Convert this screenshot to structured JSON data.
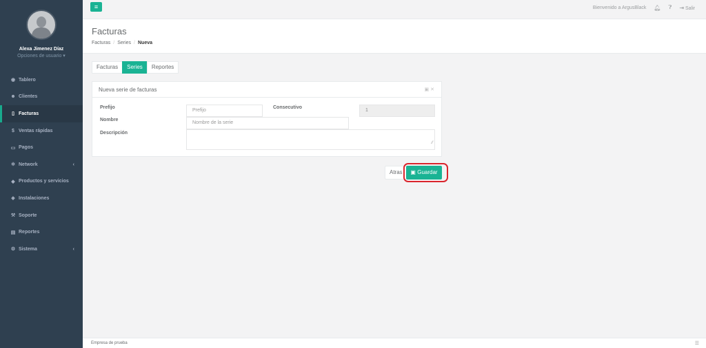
{
  "sidebar": {
    "user_name": "Alexa Jimenez Díaz",
    "user_options": "Opciones de usuario ▾",
    "items": [
      {
        "label": "Tablero",
        "icon": "dashboard-icon"
      },
      {
        "label": "Clientes",
        "icon": "users-icon"
      },
      {
        "label": "Facturas",
        "icon": "file-icon",
        "active": true
      },
      {
        "label": "Ventas rápidas",
        "icon": "dollar-icon"
      },
      {
        "label": "Pagos",
        "icon": "money-icon"
      },
      {
        "label": "Network",
        "icon": "network-icon",
        "has_children": true
      },
      {
        "label": "Productos y servicios",
        "icon": "tag-icon"
      },
      {
        "label": "Instalaciones",
        "icon": "tools-icon"
      },
      {
        "label": "Soporte",
        "icon": "wrench-icon"
      },
      {
        "label": "Reportes",
        "icon": "book-icon"
      },
      {
        "label": "Sistema",
        "icon": "cogs-icon",
        "has_children": true
      }
    ]
  },
  "topbar": {
    "welcome": "Bienvenido a ArgusBlack",
    "logout": "Salir"
  },
  "page": {
    "title": "Facturas",
    "breadcrumb": [
      "Facturas",
      "Series",
      "Nueva"
    ]
  },
  "tabs": [
    {
      "label": "Facturas",
      "active": false
    },
    {
      "label": "Series",
      "active": true
    },
    {
      "label": "Reportes",
      "active": false
    }
  ],
  "panel": {
    "title": "Nueva serie de facturas",
    "fields": {
      "prefijo_label": "Prefijo",
      "prefijo_placeholder": "Prefijo",
      "consecutivo_label": "Consecutivo",
      "consecutivo_value": "1",
      "nombre_label": "Nombre",
      "nombre_placeholder": "Nombre de la serie",
      "descripcion_label": "Descripción"
    }
  },
  "actions": {
    "back": "Atras",
    "save": "Guardar"
  },
  "footer": {
    "company": "Empresa de prueba"
  },
  "colors": {
    "accent": "#1ab394",
    "sidebar": "#2f4050",
    "highlight": "#d9242c"
  }
}
